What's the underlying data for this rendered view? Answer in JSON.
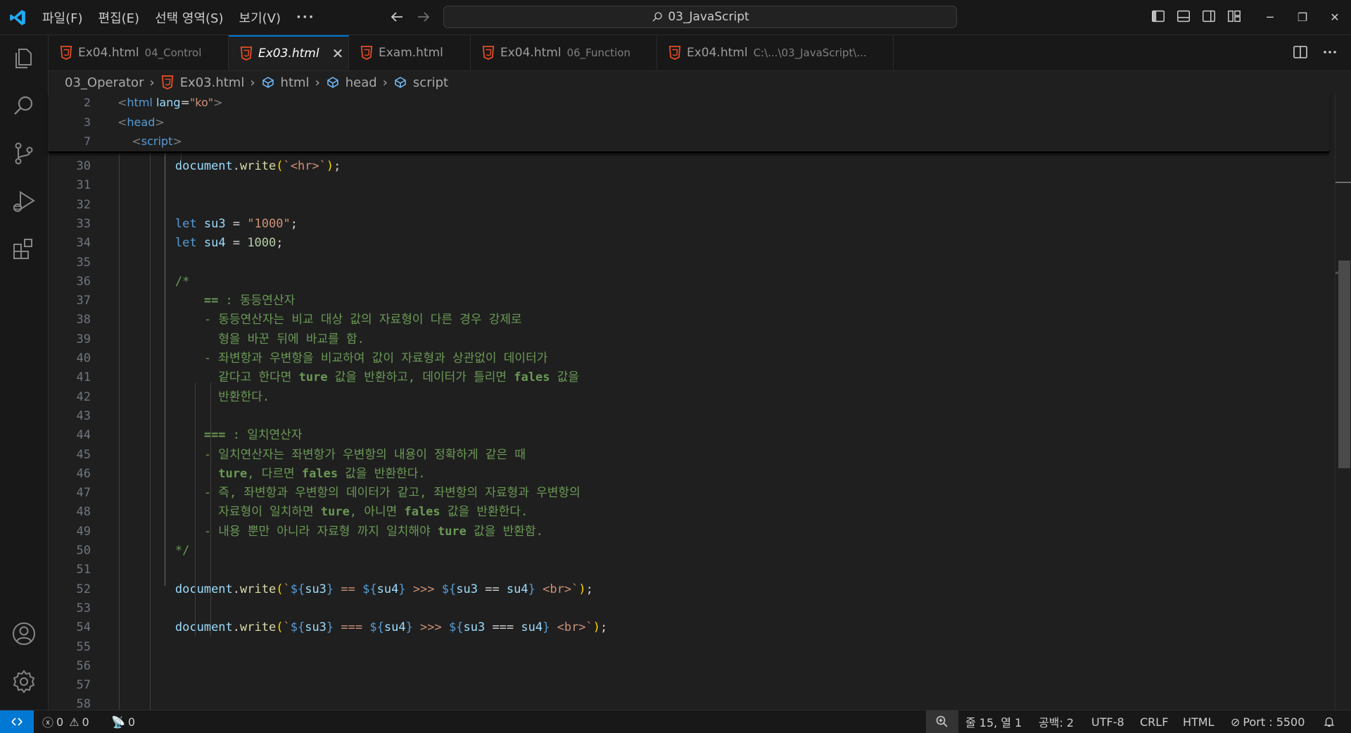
{
  "menu": {
    "items": [
      "파일(F)",
      "편집(E)",
      "선택 영역(S)",
      "보기(V)"
    ],
    "more": "···"
  },
  "command_center": {
    "text": "03_JavaScript"
  },
  "tabs": [
    {
      "name": "Ex04.html",
      "desc": "04_Control",
      "italic": false,
      "active": false
    },
    {
      "name": "Ex03.html",
      "desc": "",
      "italic": true,
      "active": true,
      "close": "✕"
    },
    {
      "name": "Exam.html",
      "desc": "",
      "italic": false,
      "active": false
    },
    {
      "name": "Ex04.html",
      "desc": "06_Function",
      "italic": false,
      "active": false
    },
    {
      "name": "Ex04.html",
      "desc": "C:\\...\\03_JavaScript\\...",
      "italic": false,
      "active": false
    }
  ],
  "breadcrumb": [
    "03_Operator",
    "Ex03.html",
    "html",
    "head",
    "script"
  ],
  "sticky_lines": [
    {
      "num": "2",
      "tokens": [
        [
          "t-punc",
          "<"
        ],
        [
          "t-tag",
          "html"
        ],
        [
          "t-plain",
          " "
        ],
        [
          "t-attr",
          "lang"
        ],
        [
          "t-plain",
          "="
        ],
        [
          "t-str",
          "\"ko\""
        ],
        [
          "t-punc",
          ">"
        ]
      ]
    },
    {
      "num": "3",
      "tokens": [
        [
          "t-punc",
          "<"
        ],
        [
          "t-tag",
          "head"
        ],
        [
          "t-punc",
          ">"
        ]
      ]
    },
    {
      "num": "7",
      "tokens": [
        [
          "t-plain",
          "    "
        ],
        [
          "t-punc",
          "<"
        ],
        [
          "t-tag",
          "script"
        ],
        [
          "t-punc",
          ">"
        ]
      ]
    }
  ],
  "code_lines": [
    {
      "num": "30",
      "tokens": [
        [
          "t-plain",
          "        "
        ],
        [
          "t-var",
          "document"
        ],
        [
          "t-plain",
          "."
        ],
        [
          "t-fn",
          "write"
        ],
        [
          "t-br",
          "("
        ],
        [
          "t-str",
          "`<hr>`"
        ],
        [
          "t-br",
          ")"
        ],
        [
          "t-plain",
          ";"
        ]
      ]
    },
    {
      "num": "31",
      "tokens": []
    },
    {
      "num": "32",
      "tokens": []
    },
    {
      "num": "33",
      "tokens": [
        [
          "t-plain",
          "        "
        ],
        [
          "t-kw",
          "let"
        ],
        [
          "t-plain",
          " "
        ],
        [
          "t-var",
          "su3"
        ],
        [
          "t-plain",
          " = "
        ],
        [
          "t-str",
          "\"1000\""
        ],
        [
          "t-plain",
          ";"
        ]
      ]
    },
    {
      "num": "34",
      "tokens": [
        [
          "t-plain",
          "        "
        ],
        [
          "t-kw",
          "let"
        ],
        [
          "t-plain",
          " "
        ],
        [
          "t-var",
          "su4"
        ],
        [
          "t-plain",
          " = "
        ],
        [
          "t-num",
          "1000"
        ],
        [
          "t-plain",
          ";"
        ]
      ]
    },
    {
      "num": "35",
      "tokens": []
    },
    {
      "num": "36",
      "tokens": [
        [
          "t-plain",
          "        "
        ],
        [
          "t-cmt",
          "/*"
        ]
      ]
    },
    {
      "num": "37",
      "tokens": [
        [
          "t-plain",
          "            "
        ],
        [
          "t-bold",
          "=="
        ],
        [
          "t-cmt",
          " : 동등연산자"
        ]
      ]
    },
    {
      "num": "38",
      "tokens": [
        [
          "t-plain",
          "            "
        ],
        [
          "t-cmt",
          "- 동등연산자는 비교 대상 값의 자료형이 다른 경우 강제로"
        ]
      ]
    },
    {
      "num": "39",
      "tokens": [
        [
          "t-plain",
          "              "
        ],
        [
          "t-cmt",
          "형을 바꾼 뒤에 바교를 함."
        ]
      ]
    },
    {
      "num": "40",
      "tokens": [
        [
          "t-plain",
          "            "
        ],
        [
          "t-cmt",
          "- 좌변항과 우변항을 비교하여 값이 자료형과 상관없이 데이터가"
        ]
      ]
    },
    {
      "num": "41",
      "tokens": [
        [
          "t-plain",
          "              "
        ],
        [
          "t-cmt",
          "같다고 한다면 "
        ],
        [
          "t-bold",
          "ture"
        ],
        [
          "t-cmt",
          " 값을 반환하고, 데이터가 틀리면 "
        ],
        [
          "t-bold",
          "fales"
        ],
        [
          "t-cmt",
          " 값을"
        ]
      ]
    },
    {
      "num": "42",
      "tokens": [
        [
          "t-plain",
          "              "
        ],
        [
          "t-cmt",
          "반환한다."
        ]
      ]
    },
    {
      "num": "43",
      "tokens": []
    },
    {
      "num": "44",
      "tokens": [
        [
          "t-plain",
          "            "
        ],
        [
          "t-bold",
          "==="
        ],
        [
          "t-cmt",
          " : 일치연산자"
        ]
      ]
    },
    {
      "num": "45",
      "tokens": [
        [
          "t-plain",
          "            "
        ],
        [
          "t-cmt",
          "- 일치연산자는 좌변항가 우변항의 내용이 정확하게 같은 때"
        ]
      ]
    },
    {
      "num": "46",
      "tokens": [
        [
          "t-plain",
          "              "
        ],
        [
          "t-bold",
          "ture"
        ],
        [
          "t-cmt",
          ", 다르면 "
        ],
        [
          "t-bold",
          "fales"
        ],
        [
          "t-cmt",
          " 값을 반환한다."
        ]
      ]
    },
    {
      "num": "47",
      "tokens": [
        [
          "t-plain",
          "            "
        ],
        [
          "t-cmt",
          "- 즉, 좌변항과 우변항의 데이터가 같고, 좌변항의 자료형과 우변항의"
        ]
      ]
    },
    {
      "num": "48",
      "tokens": [
        [
          "t-plain",
          "              "
        ],
        [
          "t-cmt",
          "자료형이 일치하면 "
        ],
        [
          "t-bold",
          "ture"
        ],
        [
          "t-cmt",
          ", 아니면 "
        ],
        [
          "t-bold",
          "fales"
        ],
        [
          "t-cmt",
          " 값을 반환한다."
        ]
      ]
    },
    {
      "num": "49",
      "tokens": [
        [
          "t-plain",
          "            "
        ],
        [
          "t-cmt",
          "- 내용 뿐만 아니라 자료형 까지 일치해야 "
        ],
        [
          "t-bold",
          "ture"
        ],
        [
          "t-cmt",
          " 값을 반환함."
        ]
      ]
    },
    {
      "num": "50",
      "tokens": [
        [
          "t-plain",
          "        "
        ],
        [
          "t-cmt",
          "*/"
        ]
      ]
    },
    {
      "num": "51",
      "tokens": []
    },
    {
      "num": "52",
      "tokens": [
        [
          "t-plain",
          "        "
        ],
        [
          "t-var",
          "document"
        ],
        [
          "t-plain",
          "."
        ],
        [
          "t-fn",
          "write"
        ],
        [
          "t-br",
          "("
        ],
        [
          "t-str",
          "`"
        ],
        [
          "t-tpl",
          "${"
        ],
        [
          "t-var",
          "su3"
        ],
        [
          "t-tpl",
          "}"
        ],
        [
          "t-str",
          " == "
        ],
        [
          "t-tpl",
          "${"
        ],
        [
          "t-var",
          "su4"
        ],
        [
          "t-tpl",
          "}"
        ],
        [
          "t-str",
          " >>> "
        ],
        [
          "t-tpl",
          "${"
        ],
        [
          "t-var",
          "su3"
        ],
        [
          "t-plain",
          " == "
        ],
        [
          "t-var",
          "su4"
        ],
        [
          "t-tpl",
          "}"
        ],
        [
          "t-str",
          " <br>`"
        ],
        [
          "t-br",
          ")"
        ],
        [
          "t-plain",
          ";"
        ]
      ]
    },
    {
      "num": "53",
      "tokens": []
    },
    {
      "num": "54",
      "tokens": [
        [
          "t-plain",
          "        "
        ],
        [
          "t-var",
          "document"
        ],
        [
          "t-plain",
          "."
        ],
        [
          "t-fn",
          "write"
        ],
        [
          "t-br",
          "("
        ],
        [
          "t-str",
          "`"
        ],
        [
          "t-tpl",
          "${"
        ],
        [
          "t-var",
          "su3"
        ],
        [
          "t-tpl",
          "}"
        ],
        [
          "t-str",
          " === "
        ],
        [
          "t-tpl",
          "${"
        ],
        [
          "t-var",
          "su4"
        ],
        [
          "t-tpl",
          "}"
        ],
        [
          "t-str",
          " >>> "
        ],
        [
          "t-tpl",
          "${"
        ],
        [
          "t-var",
          "su3"
        ],
        [
          "t-plain",
          " === "
        ],
        [
          "t-var",
          "su4"
        ],
        [
          "t-tpl",
          "}"
        ],
        [
          "t-str",
          " <br>`"
        ],
        [
          "t-br",
          ")"
        ],
        [
          "t-plain",
          ";"
        ]
      ]
    },
    {
      "num": "55",
      "tokens": []
    },
    {
      "num": "56",
      "tokens": []
    },
    {
      "num": "57",
      "tokens": []
    },
    {
      "num": "58",
      "tokens": []
    }
  ],
  "status": {
    "errors": "0",
    "warnings": "0",
    "ports": "0",
    "position": "줄 15, 열 1",
    "indent": "공백: 2",
    "encoding": "UTF-8",
    "eol": "CRLF",
    "language": "HTML",
    "port": "Port : 5500"
  },
  "colors": {
    "accent": "#0078d4",
    "html_icon": "#e44d26",
    "comment": "#6a9955"
  }
}
